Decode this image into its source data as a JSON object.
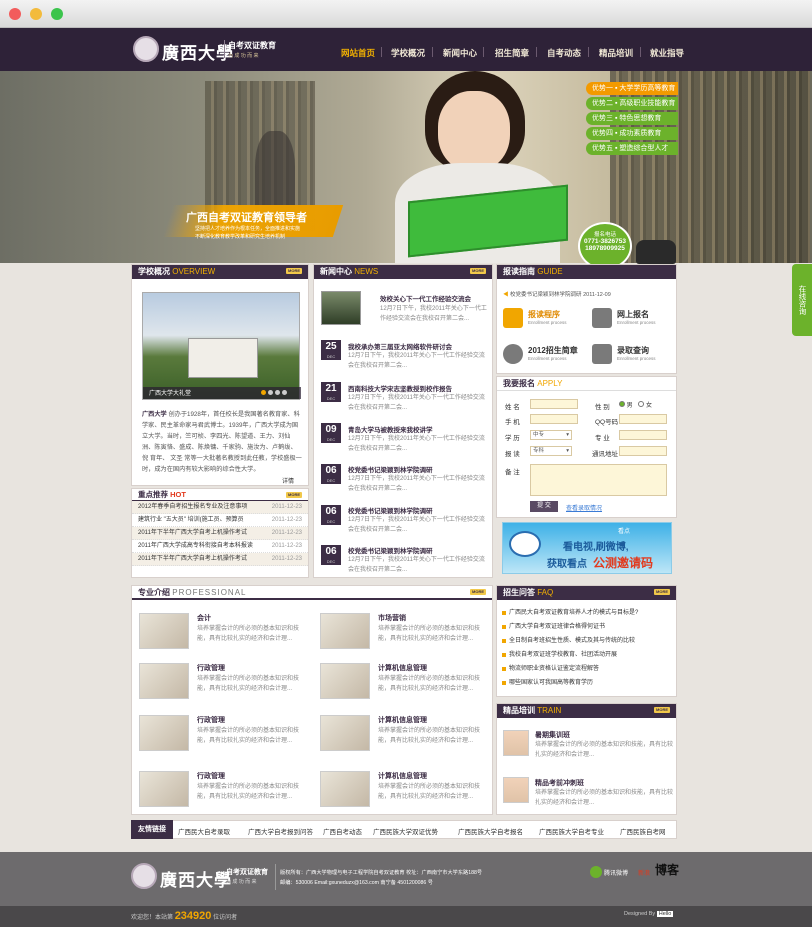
{
  "site": {
    "name": "廣西大學",
    "tagline": "自考双证教育",
    "slogan": "为 成 功 而 来"
  },
  "nav": [
    "网站首页",
    "学校概况",
    "新闻中心",
    "招生简章",
    "自考动态",
    "精品培训",
    "就业指导"
  ],
  "banner": {
    "headline": "广西自考双证教育领导者",
    "sub1": "坚持把人才培养作为根本任务，全面推进和实施",
    "sub2": "不断深化教育教学改革和研究生培养机制",
    "advantages": [
      {
        "label": "优势一",
        "text": "大学学历高等教育"
      },
      {
        "label": "优势二",
        "text": "高级职业技能教育"
      },
      {
        "label": "优势三",
        "text": "特色思想教育"
      },
      {
        "label": "优势四",
        "text": "成功素质教育"
      },
      {
        "label": "优势五",
        "text": "塑造综合型人才"
      }
    ],
    "phone_label": "报名电话",
    "phone1": "0771-3826753",
    "phone2": "18978909925"
  },
  "side_tab": "在线咨询",
  "overview": {
    "title": "学校概况",
    "en": "OVERVIEW",
    "more": "MORE",
    "photo_caption": "广西大学大礼堂",
    "school": "广西大学",
    "text": "创办于1928年，首任校长是我国著名教育家、科学家、民主革命家马君武博士。1939年，广西大学成为国立大学。当时，竺可桢、李四光、陈望道、王力、刘仙洲、陈寅恪、盛成、陈焕镛、千家驹、施汝为、卢鹤绂、倪 育年、 文圣 常等一大批著名教授到此任教，学校盛极一时，成为在国内有较大影响的综合性大学。",
    "detail": "详情"
  },
  "hot": {
    "title": "重点推荐",
    "en": "HOT",
    "more": "MORE",
    "items": [
      {
        "text": "2012年春季自考招生报名专业及注意事项",
        "date": "2011-12-23"
      },
      {
        "text": "建筑行业 \"五大员\" 培训(施工员、预算员",
        "date": "2011-12-23"
      },
      {
        "text": "2011年下半年广西大学自考上机操作考试",
        "date": "2011-12-23"
      },
      {
        "text": "2011年广西大学成高专科衔接自考本科报读",
        "date": "2011-12-23"
      },
      {
        "text": "2011年下半年广西大学自考上机操作考试",
        "date": "2011-12-23"
      }
    ]
  },
  "news": {
    "title": "新闻中心",
    "en": "NEWS",
    "more": "MORE",
    "top": {
      "title": "效校关心下一代工作经验交流会",
      "desc": "12月7日下午，我校2011年关心下一代工作经验交流会在我校召开第二会..."
    },
    "items": [
      {
        "day": "25",
        "mon": "DEC",
        "title": "我校承办第三届亚太网络软件研讨会",
        "desc": "12月7日下午，我校2011年关心下一代工作经验交流会在我校召开第二会..."
      },
      {
        "day": "21",
        "mon": "DEC",
        "title": "西南科技大学宋志坚教授到校作报告",
        "desc": "12月7日下午，我校2011年关心下一代工作经验交流会在我校召开第二会..."
      },
      {
        "day": "09",
        "mon": "DEC",
        "title": "青岛大学马被教授来我校讲学",
        "desc": "12月7日下午，我校2011年关心下一代工作经验交流会在我校召开第二会..."
      },
      {
        "day": "06",
        "mon": "DEC",
        "title": "校党委书记梁颖到林学院调研",
        "desc": "12月7日下午，我校2011年关心下一代工作经验交流会在我校召开第二会..."
      },
      {
        "day": "06",
        "mon": "DEC",
        "title": "校党委书记梁颖到林学院调研",
        "desc": "12月7日下午，我校2011年关心下一代工作经验交流会在我校召开第二会..."
      },
      {
        "day": "06",
        "mon": "DEC",
        "title": "校党委书记梁颖到林学院调研",
        "desc": "12月7日下午，我校2011年关心下一代工作经验交流会在我校召开第二会..."
      }
    ]
  },
  "guide": {
    "title": "报读指南",
    "en": "GUIDE",
    "notice": "校党委书记梁颖到林学院调研  2011-12-09",
    "cards": [
      {
        "title": "报读程序",
        "sub": "Enrollment process"
      },
      {
        "title": "网上报名",
        "sub": "Enrollment process"
      },
      {
        "title": "2012招生简章",
        "sub": "Enrollment process"
      },
      {
        "title": "录取查询",
        "sub": "Enrollment process"
      }
    ]
  },
  "apply": {
    "title": "我要报名",
    "en": "APPLY",
    "labels": {
      "name": "姓    名",
      "gender": "性    别",
      "phone": "手    机",
      "qq": "QQ号码",
      "edu": "学    历",
      "major": "专    业",
      "course": "报    读",
      "address": "通讯地址",
      "note": "备    注"
    },
    "gender_male": "男",
    "gender_female": "女",
    "edu_value": "中专",
    "course_value": "专科",
    "submit": "提 交",
    "query": "查看录取情况"
  },
  "weibo_ad": {
    "brand": "看点",
    "line1": "看电视,刷微博,",
    "line2": "获取看点",
    "highlight": "公测邀请码"
  },
  "professional": {
    "title": "专业介绍",
    "en": "PROFESSIONAL",
    "more": "MORE",
    "desc": "培养掌握会计的所必须的基本知识和技能，具有比较扎实的经济和会计理...",
    "items": [
      "会计",
      "市场营销",
      "行政管理",
      "计算机信息管理",
      "行政管理",
      "计算机信息管理",
      "行政管理",
      "计算机信息管理"
    ]
  },
  "faq": {
    "title": "招生问答",
    "en": "FAQ",
    "more": "MORE",
    "items": [
      "广西民大自考双证教育培养人才的模式与目标是?",
      "广西大学自考双证班律合格得何证书",
      "全日制自考班招生性质、模式及其与传统的比较",
      "我校自考双证班学校教育、社团活动开展",
      "物流师职业资格认证鉴定流程解答",
      "哪些国家认可我国高等教育学历"
    ]
  },
  "train": {
    "title": "精品培训",
    "en": "TRAIN",
    "more": "MORE",
    "items": [
      {
        "title": "暑期集训班",
        "desc": "培养掌握会计的所必须的基本知识和技能，具有比较扎实的经济和会计理..."
      },
      {
        "title": "精品考前冲刺班",
        "desc": "培养掌握会计的所必须的基本知识和技能，具有比较扎实的经济和会计理..."
      }
    ]
  },
  "links": {
    "title": "友情链接",
    "items": [
      "广西民大自考录取",
      "广西大学自考报到问答",
      "广西自考动态",
      "广西民族大学双证优势",
      "广西民族大学自考报名",
      "广西民族大学自考专业",
      "广西民族自考网"
    ]
  },
  "footer": {
    "copyright": "版权所有：广西大学物理与电子工程学院自考双证教育   校址：广西南宁市大学东路188号",
    "contact": "邮编：530006 Email:gxuneduzx@163.com  南宁备 4501200086 号",
    "weibo": "腾讯微博",
    "sina": "新浪",
    "blog": "博客",
    "visitors_label": "欢迎您！本站第",
    "visitors": "234920",
    "visitors_suffix": "位访问者",
    "designed": "Designed By",
    "designer": "Hello"
  },
  "colors": {
    "header": "#2e2238",
    "accent": "#f1a600",
    "green": "#6cb22b"
  }
}
